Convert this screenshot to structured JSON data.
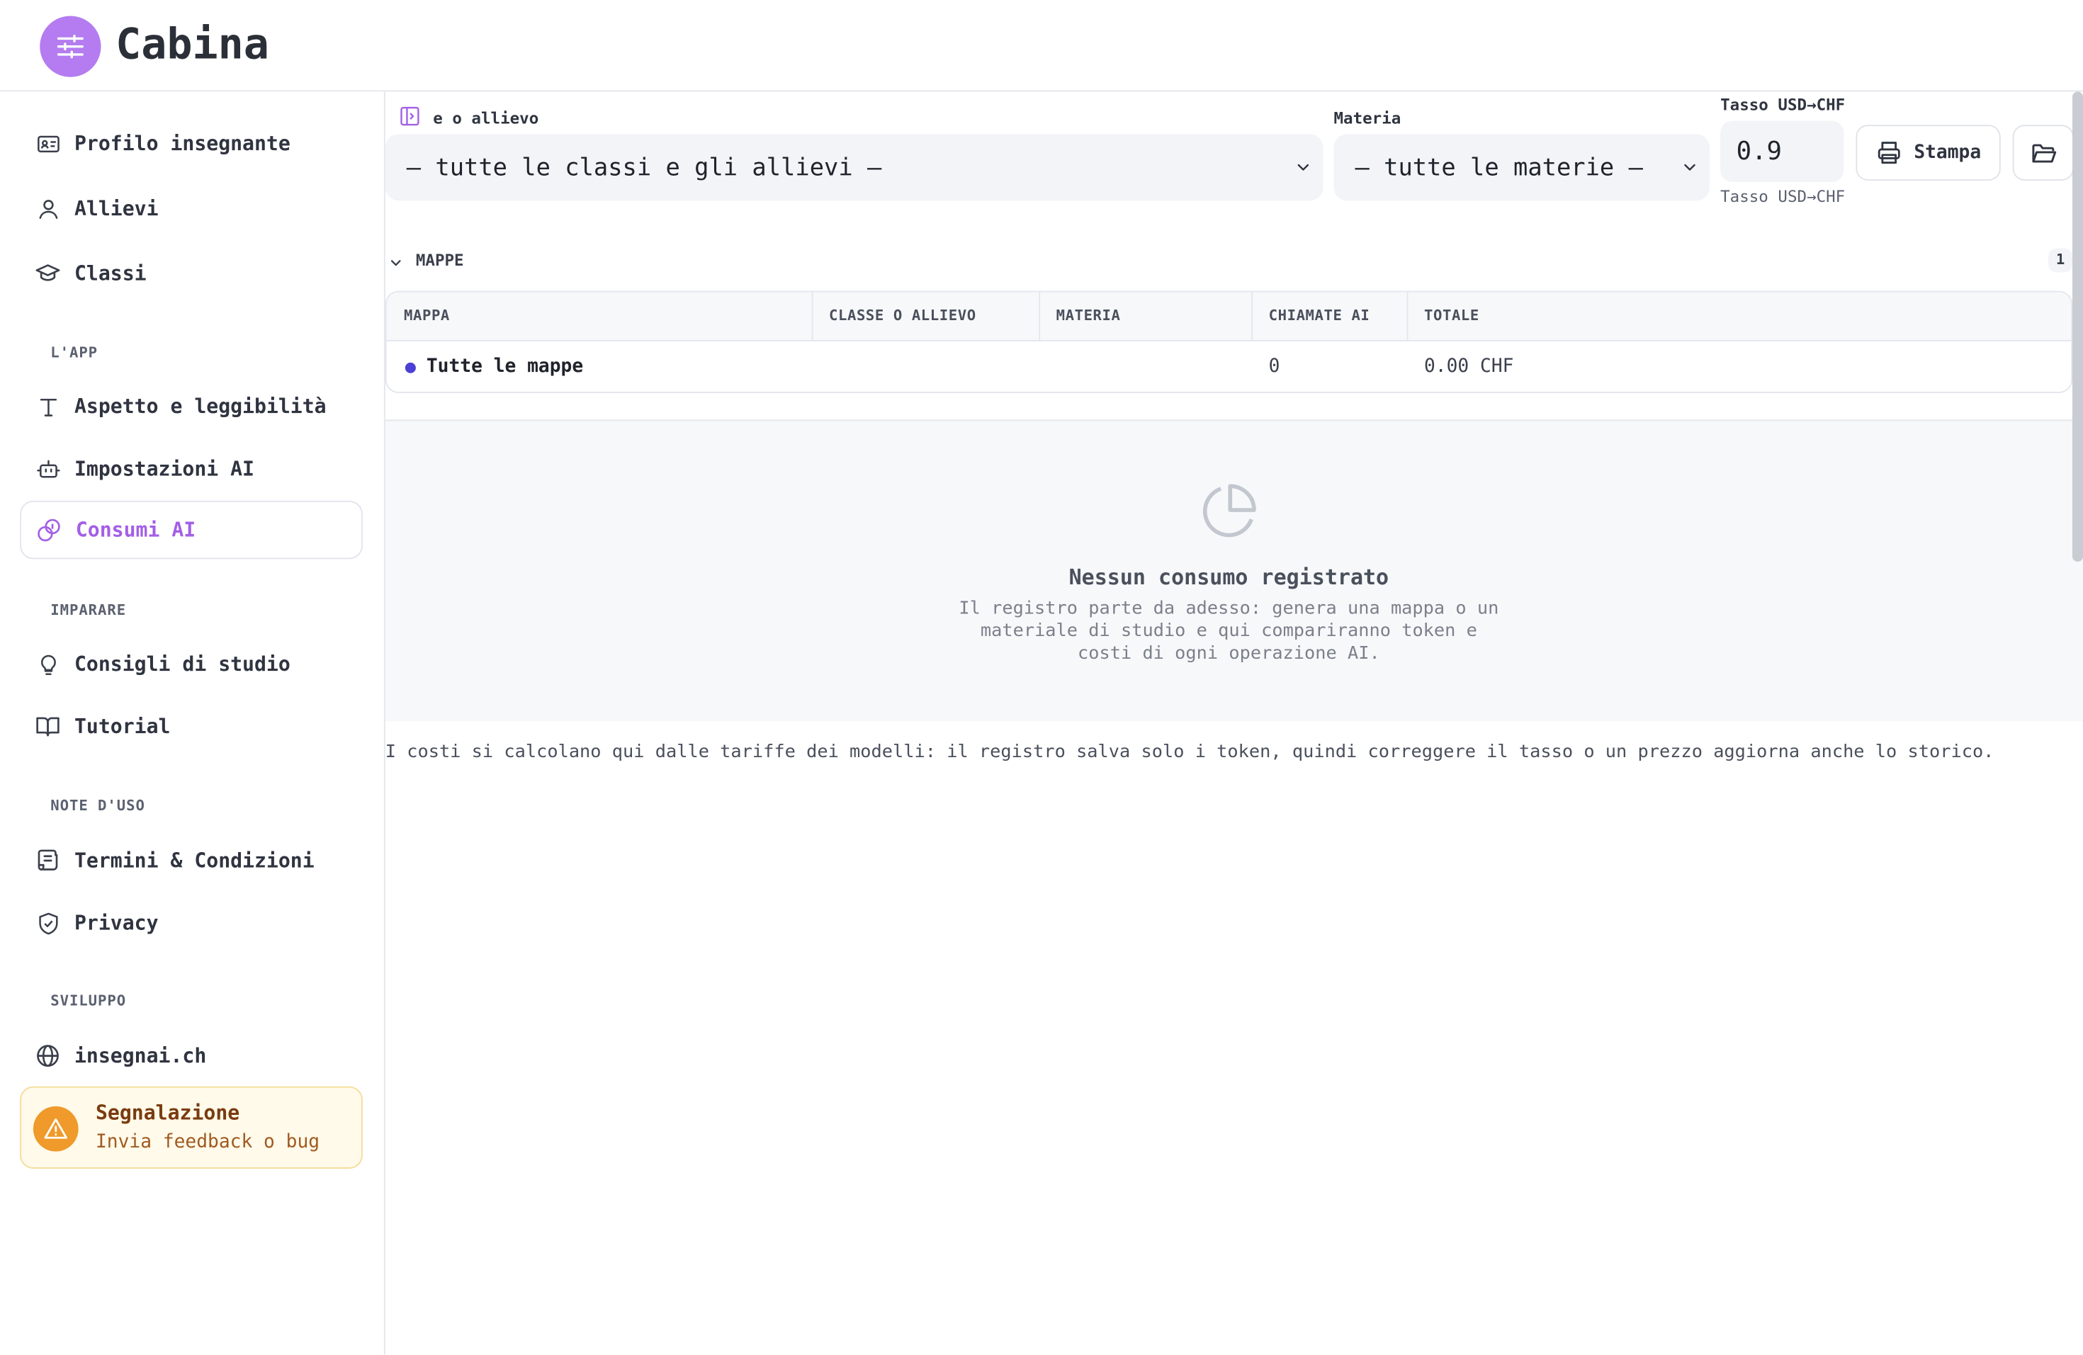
{
  "app": {
    "title": "Cabina"
  },
  "sidebar": {
    "items_top": [
      {
        "label": "Profilo insegnante",
        "icon": "id-card-icon"
      },
      {
        "label": "Allievi",
        "icon": "user-icon"
      },
      {
        "label": "Classi",
        "icon": "graduation-cap-icon"
      }
    ],
    "sections": {
      "app": "L'APP",
      "learn": "IMPARARE",
      "notes": "NOTE D'USO",
      "dev": "SVILUPPO"
    },
    "items_app": [
      {
        "label": "Aspetto e leggibilità",
        "icon": "type-icon"
      },
      {
        "label": "Impostazioni AI",
        "icon": "robot-icon"
      },
      {
        "label": "Consumi AI",
        "icon": "coins-icon",
        "active": true
      }
    ],
    "items_learn": [
      {
        "label": "Consigli di studio",
        "icon": "lightbulb-icon"
      },
      {
        "label": "Tutorial",
        "icon": "book-open-icon"
      }
    ],
    "items_notes": [
      {
        "label": "Termini & Condizioni",
        "icon": "scroll-icon"
      },
      {
        "label": "Privacy",
        "icon": "shield-check-icon"
      }
    ],
    "items_dev": [
      {
        "label": "insegnai.ch",
        "icon": "globe-icon"
      }
    ],
    "feedback": {
      "title": "Segnalazione",
      "subtitle": "Invia feedback o bug",
      "icon": "warning-icon"
    }
  },
  "filters": {
    "class_label": "e o allievo",
    "class_value": "— tutte le classi e gli allievi —",
    "subject_label": "Materia",
    "subject_value": "— tutte le materie —",
    "rate_label": "Tasso USD→CHF",
    "rate_value": "0.9",
    "rate_hint": "Tasso USD→CHF",
    "print_label": "Stampa"
  },
  "group": {
    "title": "MAPPE",
    "count": "1",
    "columns": [
      "MAPPA",
      "CLASSE O ALLIEVO",
      "MATERIA",
      "CHIAMATE AI",
      "TOTALE"
    ],
    "rows": [
      {
        "mappa": "Tutte le mappe",
        "classe": "",
        "materia": "",
        "chiamate": "0",
        "totale": "0.00 CHF"
      }
    ]
  },
  "empty": {
    "title": "Nessun consumo registrato",
    "description": "Il registro parte da adesso: genera una mappa o un materiale di studio e qui compariranno token e costi di ogni operazione AI."
  },
  "footnote": "I costi si calcolano qui dalle tariffe dei modelli: il registro salva solo i token, quindi correggere il tasso o un prezzo aggiorna anche lo storico.",
  "colors": {
    "accent": "#a35fe6",
    "logo": "#b47cf0",
    "dot": "#4b3fd6",
    "warning": "#ef9a2a"
  }
}
